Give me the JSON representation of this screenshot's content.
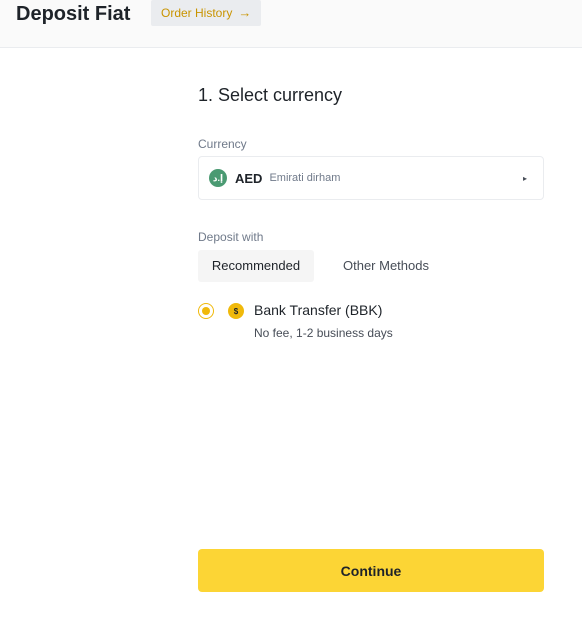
{
  "header": {
    "title": "Deposit Fiat",
    "order_history_label": "Order History",
    "order_history_icon": "arrow-right-icon"
  },
  "step": {
    "title": "1. Select currency"
  },
  "currency": {
    "label": "Currency",
    "flag_text": "إ.د",
    "code": "AED",
    "name": "Emirati dirham",
    "caret": "▸"
  },
  "deposit": {
    "label": "Deposit with",
    "tabs": [
      {
        "label": "Recommended",
        "active": true
      },
      {
        "label": "Other Methods",
        "active": false
      }
    ],
    "method": {
      "name": "Bank Transfer (BBK)",
      "description": "No fee, 1-2 business days",
      "icon_text": "$",
      "selected": true
    }
  },
  "actions": {
    "continue_label": "Continue"
  },
  "colors": {
    "accent": "#fcd535",
    "accent_text": "#c99400",
    "radio": "#f0b90b",
    "flag": "#4a9a72"
  }
}
